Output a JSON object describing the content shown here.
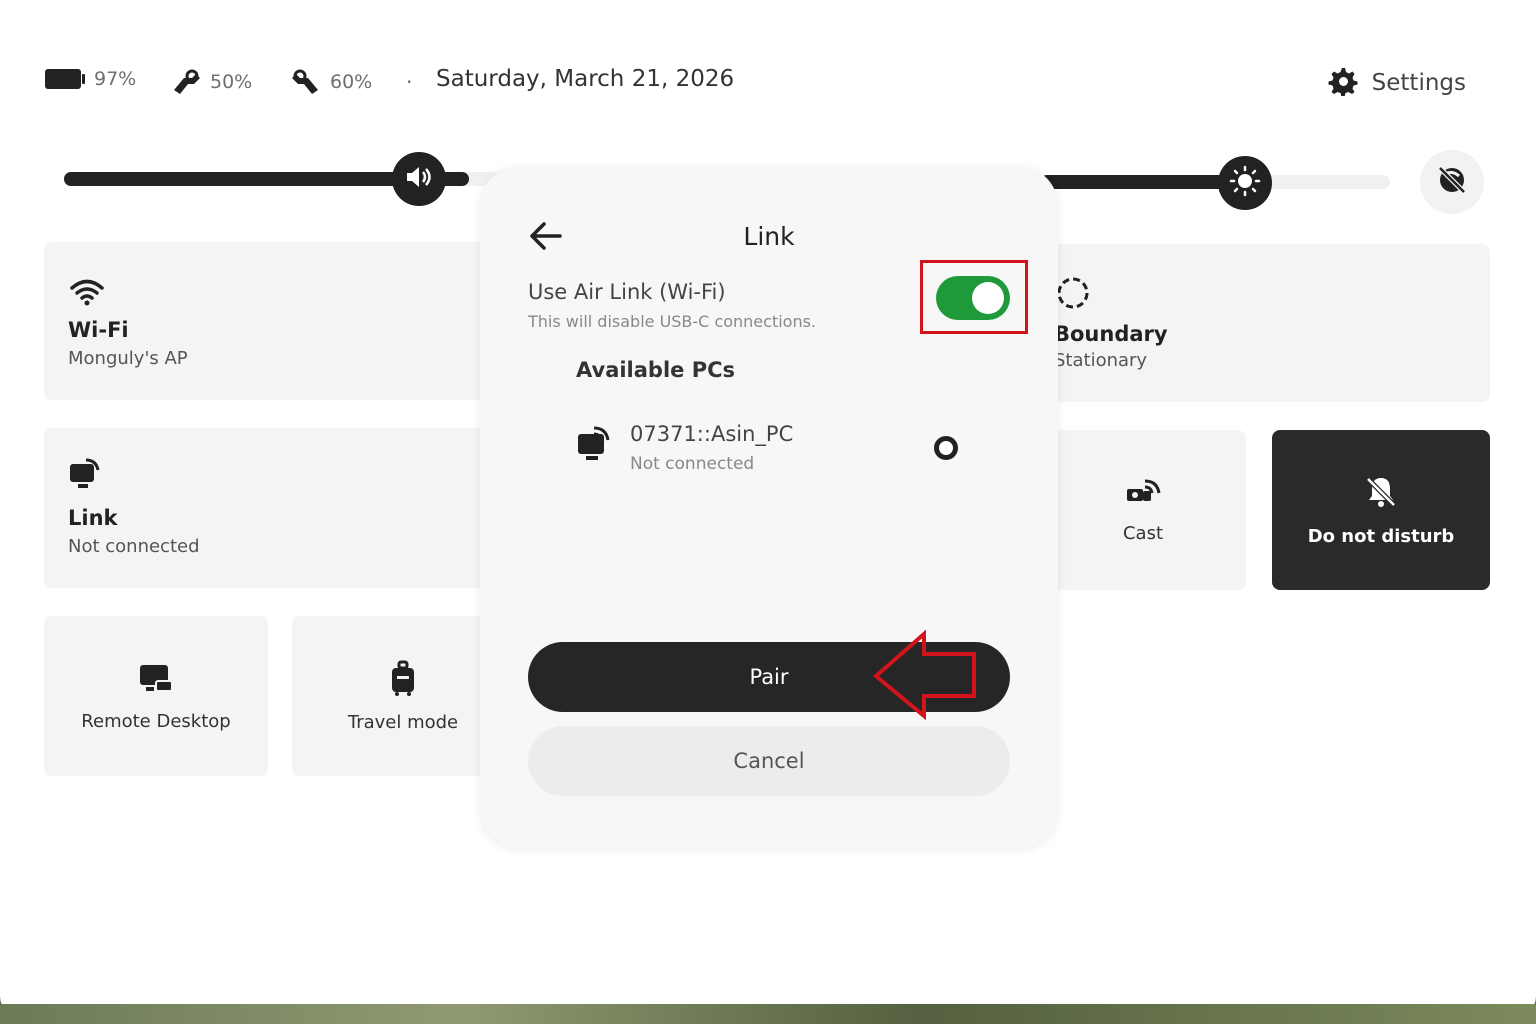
{
  "status": {
    "headset_battery": "97%",
    "left_controller_battery": "50%",
    "right_controller_battery": "60%",
    "separator": "·",
    "date": "Saturday, March 21, 2026",
    "settings_label": "Settings"
  },
  "sliders": {
    "volume_level": 0.92,
    "brightness_level": 0.58
  },
  "tiles": {
    "wifi": {
      "title": "Wi-Fi",
      "subtitle": "Monguly's AP"
    },
    "link": {
      "title": "Link",
      "subtitle": "Not connected"
    },
    "boundary": {
      "title": "Boundary",
      "subtitle": "Stationary"
    },
    "cast": {
      "label": "Cast"
    },
    "dnd": {
      "label": "Do not disturb"
    },
    "remote_desktop": {
      "label": "Remote Desktop"
    },
    "travel_mode": {
      "label": "Travel mode"
    }
  },
  "dialog": {
    "title": "Link",
    "air_link_label": "Use Air Link (Wi-Fi)",
    "air_link_note": "This will disable USB-C connections.",
    "air_link_enabled": true,
    "section_title": "Available PCs",
    "pcs": [
      {
        "name": "07371::Asin_PC",
        "status": "Not connected",
        "selected": false
      }
    ],
    "primary_button": "Pair",
    "secondary_button": "Cancel"
  },
  "colors": {
    "toggle_on": "#1f9a3a",
    "annotation": "#d3141c",
    "dark": "#262626"
  }
}
